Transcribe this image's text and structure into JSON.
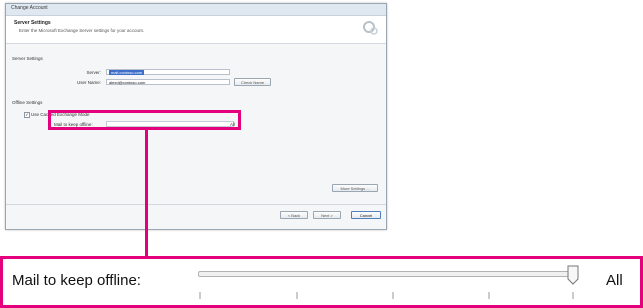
{
  "window": {
    "title": "Change Account"
  },
  "header": {
    "title": "Server Settings",
    "subtitle": "Enter the Microsoft Exchange Server settings for your account."
  },
  "server_settings": {
    "section_label": "Server Settings",
    "server_label": "Server:",
    "server_value": "mail.contoso.com",
    "username_label": "User Name:",
    "username_value": "alexd@contoso.com",
    "check_name_button": "Check Name"
  },
  "offline_settings": {
    "section_label": "Offline Settings",
    "cached_mode_label": "Use Cached Exchange Mode",
    "mail_offline_label": "Mail to keep offline:",
    "mail_offline_value": "All"
  },
  "more_settings_button": "More Settings ...",
  "footer": {
    "back_button": "< Back",
    "next_button": "Next >",
    "cancel_button": "Cancel"
  },
  "zoom_callout": {
    "label": "Mail to keep offline:",
    "value": "All",
    "slider_fraction": 1.0
  },
  "colors": {
    "accent": "#e4007c",
    "selection": "#3d6ec9"
  }
}
